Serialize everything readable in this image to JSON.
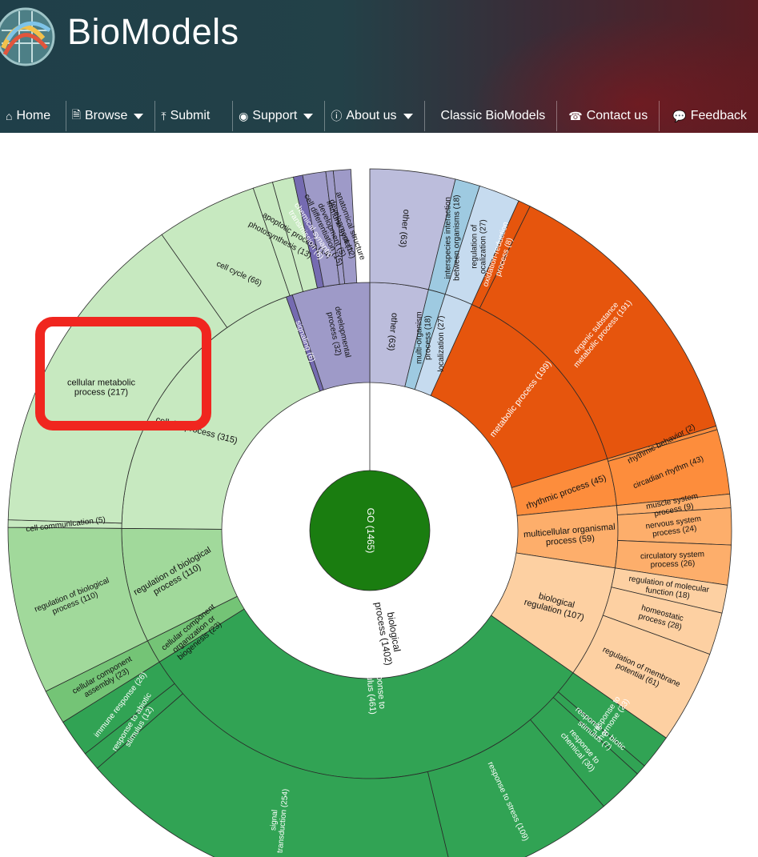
{
  "header": {
    "brand": "BioModels",
    "nav": [
      {
        "label": "Home",
        "icon": "home-icon"
      },
      {
        "label": "Browse",
        "icon": "browse-icon",
        "dropdown": true
      },
      {
        "label": "Submit",
        "icon": "upload-icon"
      },
      {
        "label": "Support",
        "icon": "lifebuoy-icon",
        "dropdown": true
      },
      {
        "label": "About us",
        "icon": "info-icon",
        "dropdown": true
      },
      {
        "label": "Classic BioModels"
      },
      {
        "label": "Contact us",
        "icon": "phone-icon"
      },
      {
        "label": "Feedback",
        "icon": "comment-icon"
      }
    ]
  },
  "colors": {
    "go_center": "#1a7d10",
    "biological_process": "#69aed6",
    "cellular_process": "#c4e6bd",
    "response_to_stimulus": "#31a354",
    "metabolic_process": "#e6550d",
    "rhythmic_process": "#fd8d3c",
    "biological_regulation": "#fdd0a2",
    "developmental_process": "#9e9ac8",
    "signaling": "#756bb1",
    "localization": "#c6dbef",
    "highlight": "#f0261f"
  },
  "chart": {
    "center_label": "GO (1465)",
    "inner_label": "biological process (1402)",
    "ring2": [
      {
        "label": "other (63)"
      },
      {
        "label": "multi-organism process (18)"
      },
      {
        "label": "localization (27)"
      },
      {
        "label": "metabolic process (199)"
      },
      {
        "label": "rhythmic process (45)"
      },
      {
        "label": "multicellular organismal process (59)"
      },
      {
        "label": "biological regulation (107)"
      },
      {
        "label": "response to stimulus (461)"
      },
      {
        "label": "cellular component organization or biogenesis (23)"
      },
      {
        "label": "regulation of biological process (110)"
      },
      {
        "label": "cellular process (315)"
      },
      {
        "label": "signaling (6)"
      },
      {
        "label": "developmental process (32)"
      }
    ],
    "ring3": [
      {
        "label": "other (63)"
      },
      {
        "label": "interspecies interaction between organisms (18)"
      },
      {
        "label": "regulation of localization (27)"
      },
      {
        "label": "oxidation-reduction process (8)"
      },
      {
        "label": "organic substance metabolic process (191)"
      },
      {
        "label": "rhythmic behavior (2)"
      },
      {
        "label": "circadian rhythm (43)"
      },
      {
        "label": "muscle system process (9)"
      },
      {
        "label": "nervous system process (24)"
      },
      {
        "label": "circulatory system process (26)"
      },
      {
        "label": "regulation of molecular function (18)"
      },
      {
        "label": "homeostatic process (28)"
      },
      {
        "label": "regulation of membrane potential (61)"
      },
      {
        "label": "response to hormone (23)"
      },
      {
        "label": "response to biotic stimulus (7)"
      },
      {
        "label": "response to chemical (30)"
      },
      {
        "label": "response to stress (109)"
      },
      {
        "label": "signal transduction (254)"
      },
      {
        "label": "response to abiotic stimulus (12)"
      },
      {
        "label": "immune response (26)"
      },
      {
        "label": "cellular component assembly (23)"
      },
      {
        "label": "regulation of biological process (110)"
      },
      {
        "label": "cell communication (5)"
      },
      {
        "label": "cellular metabolic process (217)"
      },
      {
        "label": "cell cycle (66)"
      },
      {
        "label": "photosynthesis (13)"
      },
      {
        "label": "apoptotic process (14)"
      },
      {
        "label": "chemical synaptic transmission (6)"
      },
      {
        "label": "cell differentiation (15)"
      },
      {
        "label": "immune system development (5)"
      },
      {
        "label": "anatomical structure development (12)"
      }
    ]
  }
}
